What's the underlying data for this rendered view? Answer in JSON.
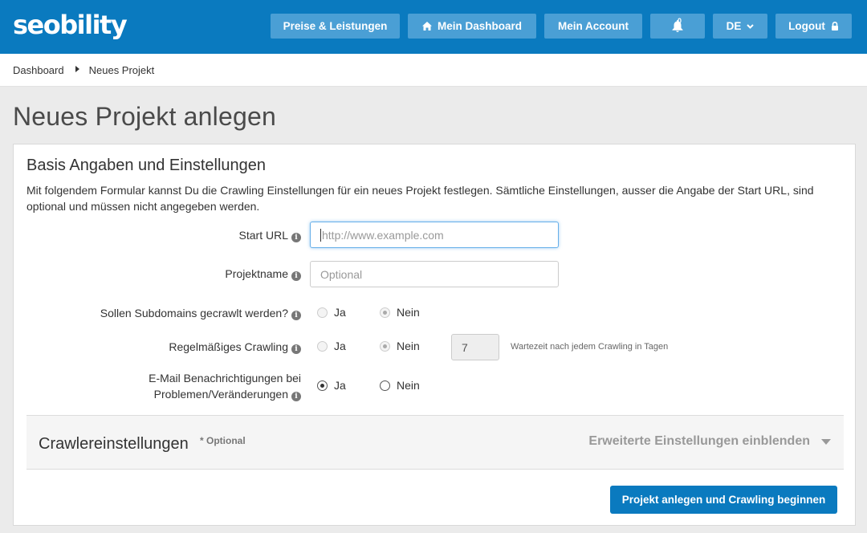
{
  "header": {
    "logo": "seobility",
    "nav": {
      "pricing": "Preise & Leistungen",
      "dashboard": "Mein Dashboard",
      "account": "Mein Account",
      "notifications_count": "0",
      "language": "DE",
      "logout": "Logout"
    }
  },
  "breadcrumb": {
    "home": "Dashboard",
    "current": "Neues Projekt"
  },
  "page_title": "Neues Projekt anlegen",
  "form": {
    "section_title": "Basis Angaben und Einstellungen",
    "description": "Mit folgendem Formular kannst Du die Crawling Einstellungen für ein neues Projekt festlegen. Sämtliche Einstellungen, ausser die Angabe der Start URL, sind optional und müssen nicht angegeben werden.",
    "start_url": {
      "label": "Start URL",
      "value": "",
      "placeholder": "http://www.example.com"
    },
    "project_name": {
      "label": "Projektname",
      "value": "",
      "placeholder": "Optional"
    },
    "subdomains": {
      "label": "Sollen Subdomains gecrawlt werden?",
      "option_yes": "Ja",
      "option_no": "Nein",
      "selected": "Nein"
    },
    "regular_crawling": {
      "label": "Regelmäßiges Crawling",
      "option_yes": "Ja",
      "option_no": "Nein",
      "selected": "Nein",
      "days_value": "7",
      "days_hint": "Wartezeit nach jedem Crawling in Tagen"
    },
    "email_notifications": {
      "label_line1": "E-Mail Benachrichtigungen bei",
      "label_line2": "Problemen/Veränderungen",
      "option_yes": "Ja",
      "option_no": "Nein",
      "selected": "Ja"
    },
    "info_glyph": "i"
  },
  "crawler_settings": {
    "title": "Crawlereinstellungen",
    "optional": "* Optional",
    "toggle_label": "Erweiterte Einstellungen einblenden"
  },
  "submit_label": "Projekt anlegen und Crawling beginnen",
  "colors": {
    "brand": "#0a7abf",
    "nav_button": "#4a9fd5"
  }
}
